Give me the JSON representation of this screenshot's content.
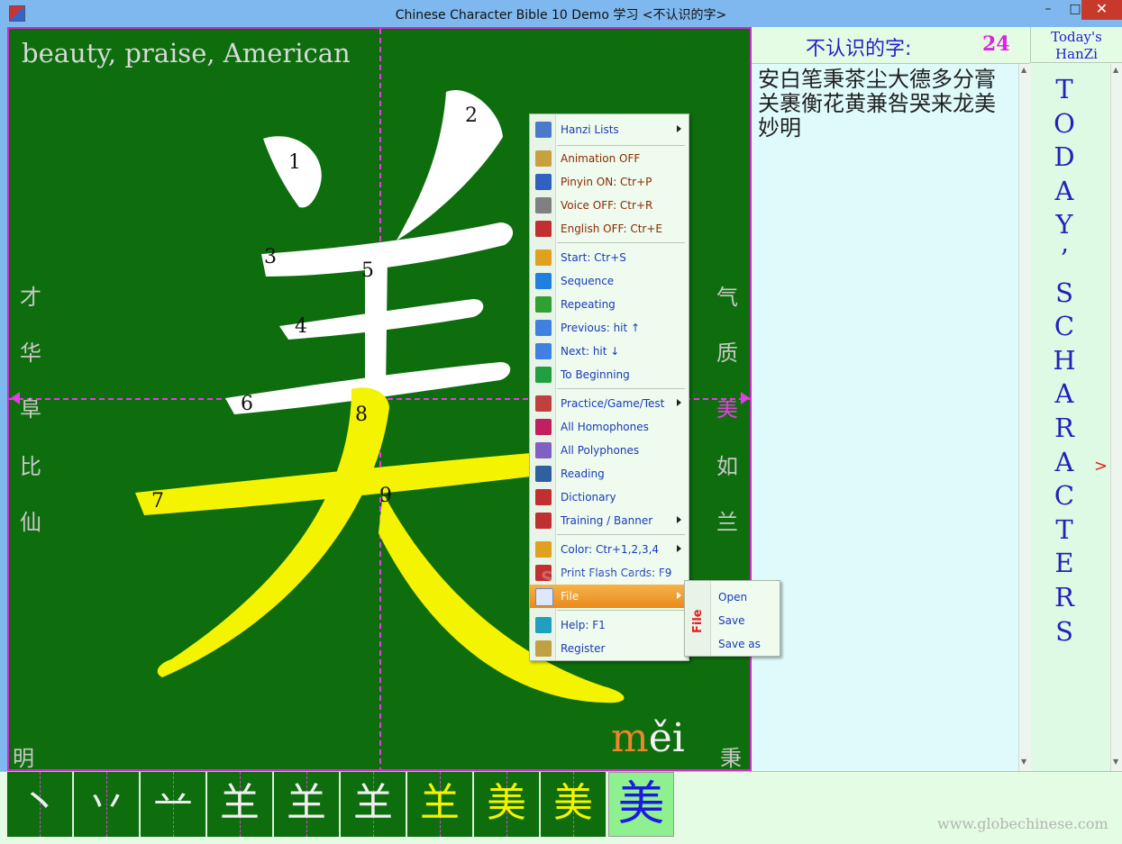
{
  "window": {
    "title": "Chinese Character Bible   10   Demo          学习 <不认识的字>",
    "minimize": "–",
    "maximize": "□",
    "close": "✕"
  },
  "canvas": {
    "english": "beauty, praise, American",
    "character": "美",
    "pinyin_initial": "m",
    "pinyin_rest": "ěi",
    "stroke_numbers": [
      "1",
      "2",
      "3",
      "4",
      "5",
      "6",
      "7",
      "8",
      "9"
    ],
    "left_chars": [
      "才",
      "华",
      "阜",
      "比",
      "仙",
      "明"
    ],
    "right_chars": [
      "气",
      "质",
      "美",
      "如",
      "兰",
      "秉"
    ]
  },
  "right_panel": {
    "unknown_label": "不认识的字:",
    "unknown_count": "24",
    "today_header_line1": "Today's",
    "today_header_line2": "HanZi",
    "characters": "安白笔秉茶尘大德多分膏关裹衡花黄兼咎哭来龙美妙明",
    "today_vertical": [
      "T",
      "O",
      "D",
      "A",
      "Y",
      "’",
      "S",
      " ",
      "C",
      "H",
      "A",
      "R",
      "A",
      "C",
      "T",
      "E",
      "R",
      "S"
    ],
    "today_arrow": ">"
  },
  "context_menu": {
    "items": [
      {
        "label": "Hanzi Lists",
        "submenu": true,
        "style": "blue",
        "icon": "hanzi-lists-icon",
        "color": "#4a7ac8"
      },
      {
        "label": "Animation OFF",
        "style": "brown",
        "icon": "animation-icon",
        "color": "#c8a040"
      },
      {
        "label": "Pinyin ON: Ctr+P",
        "style": "brown",
        "icon": "pinyin-icon",
        "color": "#3060c0"
      },
      {
        "label": "Voice OFF: Ctr+R",
        "style": "brown",
        "icon": "voice-icon",
        "color": "#808080"
      },
      {
        "label": "English OFF: Ctr+E",
        "style": "brown",
        "icon": "english-icon",
        "color": "#c03030"
      },
      {
        "label": "Start: Ctr+S",
        "style": "blue",
        "icon": "start-icon",
        "color": "#e0a020"
      },
      {
        "label": "Sequence",
        "style": "blue",
        "icon": "sequence-icon",
        "color": "#2080e0"
      },
      {
        "label": "Repeating",
        "style": "blue",
        "icon": "repeating-icon",
        "color": "#30a030"
      },
      {
        "label": "Previous: hit ↑",
        "style": "blue",
        "icon": "previous-icon",
        "color": "#4080e0"
      },
      {
        "label": "Next: hit ↓",
        "style": "blue",
        "icon": "next-icon",
        "color": "#4080e0"
      },
      {
        "label": "To Beginning",
        "style": "blue",
        "icon": "to-beginning-icon",
        "color": "#20a040"
      },
      {
        "label": "Practice/Game/Test",
        "submenu": true,
        "style": "blue",
        "icon": "practice-icon",
        "color": "#c04040"
      },
      {
        "label": "All Homophones",
        "style": "blue",
        "icon": "homophones-icon",
        "color": "#c02060"
      },
      {
        "label": "All Polyphones",
        "style": "blue",
        "icon": "polyphones-icon",
        "color": "#8060c0"
      },
      {
        "label": "Reading",
        "style": "blue",
        "icon": "reading-icon",
        "color": "#3060a0"
      },
      {
        "label": "Dictionary",
        "style": "blue",
        "icon": "dictionary-icon",
        "color": "#c03030"
      },
      {
        "label": "Training / Banner",
        "submenu": true,
        "style": "blue",
        "icon": "training-icon",
        "color": "#c03030"
      },
      {
        "label": "Color: Ctr+1,2,3,4",
        "submenu": true,
        "style": "blue",
        "icon": "color-icon",
        "color": "#e0a020"
      },
      {
        "label": "Print Flash Cards: F9",
        "style": "blue",
        "icon": "print-icon",
        "color": "#c03030"
      },
      {
        "label": "File",
        "submenu": true,
        "style": "sel",
        "icon": "file-icon",
        "color": "#4a7ac8"
      },
      {
        "label": "Help: F1",
        "style": "blue",
        "icon": "help-icon",
        "color": "#20a0c0"
      },
      {
        "label": "Register",
        "style": "blue",
        "icon": "register-icon",
        "color": "#c0a040"
      }
    ]
  },
  "file_submenu": {
    "side_label": "File",
    "items": [
      "Open",
      "Save",
      "Save as"
    ]
  },
  "watermark": "SOFTPEDIA",
  "stroke_tiles": [
    "丶",
    "丷",
    "䒑",
    "𦍌",
    "𦍌",
    "𦍌",
    "𦍌",
    "美",
    "美",
    "美"
  ],
  "footer_url": "www.globechinese.com"
}
